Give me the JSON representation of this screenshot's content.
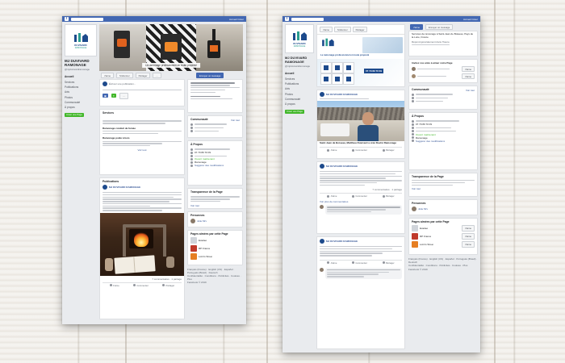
{
  "page": {
    "name_line1": "MJ DUVIVARD",
    "name_line2": "RAMONAGE",
    "handle": "@mjduvivardramonage",
    "logo_name": "DUVIVARD",
    "logo_sub": "RAMONAGE",
    "cover_tagline": "Le ramonage professionnel en toute propreté",
    "brand_color": "#1d4a8c",
    "facebook_blue": "#4267b2"
  },
  "nav": {
    "items": [
      "Accueil",
      "Services",
      "Publications",
      "Avis",
      "Photos",
      "Communauté",
      "À propos"
    ],
    "promote": "Créer une Page"
  },
  "fbbar": {
    "logo": "f",
    "right": "Accueil  Créer"
  },
  "actions": {
    "like": "J'aime",
    "follow": "S'abonner",
    "share": "Partager",
    "contact": "Envoyer un message",
    "more": "···"
  },
  "composer": {
    "placeholder": "Écrivez une publication..."
  },
  "services": {
    "title": "Services",
    "items": [
      {
        "name": "Ramonage conduit de fumée"
      },
      {
        "name": "Ramonage poêle à bois"
      }
    ],
    "see_all": "Voir tout"
  },
  "community": {
    "title": "Communauté",
    "see_all": "Voir tout"
  },
  "about": {
    "title": "À Propos",
    "hours": "Ouvert maintenant",
    "phone": "07 79 89 70 09",
    "category": "Ramonage",
    "edit": "Suggérer des modifications"
  },
  "transparency": {
    "title": "Transparence de la Page",
    "link": "Voir tout"
  },
  "people": {
    "title": "Personnes",
    "name": "Julie Mrv"
  },
  "liked_pages": {
    "title": "Pages aimées par cette Page",
    "items": [
      "Exadeo",
      "RP France",
      "Lotin's Street"
    ]
  },
  "footer": {
    "links": "Français (France) · English (US) · Español · Português (Brasil) · Deutsch",
    "legal": "Confidentialité · Conditions · Publicités · Cookies · Plus",
    "copy": "Facebook © 2019"
  },
  "posts": {
    "section_title": "Publications",
    "author": "MJ DUVIVARD RAMONAGE",
    "fire_caption": "Le ramonage est obligatoire au moins une fois par an",
    "likes": "7 commentaires · 1 partage",
    "like": "J'aime",
    "comment": "Commenter",
    "share": "Partager",
    "man_title": "Saint Jean de Boiseau, Matthieu Duvivard a créé Duvivi Ramonage",
    "ad_phone": "07 79 89 70 09",
    "ad_tagline": "Le ramonage professionnel en toute propreté",
    "comments_more": "Voir plus de commentaires"
  },
  "right": {
    "invite": "Invitez vos amis à aimer votre Page",
    "services_link": "Services de ramonage à Saint-Jean de Boiseau, Pays de la Loire, France",
    "reply": "Répond généralement dans l'heure",
    "send": "Envoyer un message"
  }
}
